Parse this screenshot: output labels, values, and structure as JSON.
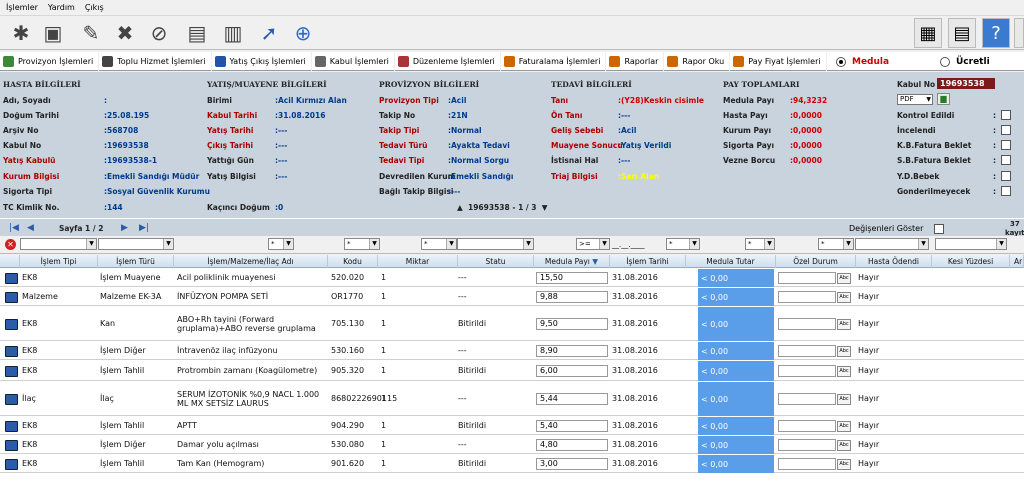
{
  "menu": [
    "İşlemler",
    "Yardım",
    "Çıkış"
  ],
  "tabs": [
    {
      "label": "Provizyon İşlemleri",
      "color": "#3a8a3a"
    },
    {
      "label": "Toplu Hizmet İşlemleri",
      "color": "#333"
    },
    {
      "label": "Yatış Çıkış İşlemleri",
      "color": "#2255aa"
    },
    {
      "label": "Kabul İşlemleri",
      "color": "#555"
    },
    {
      "label": "Düzenleme İşlemleri",
      "color": "#a33"
    },
    {
      "label": "Faturalama İşlemleri",
      "color": "#c60"
    },
    {
      "label": "Raporlar",
      "color": "#c60"
    },
    {
      "label": "Rapor Oku",
      "color": "#c60"
    },
    {
      "label": "Pay Fiyat İşlemleri",
      "color": "#c60"
    }
  ],
  "mode": {
    "medula": "Medula",
    "ucretli": "Ücretli"
  },
  "hasta": {
    "title": "HASTA BİLGİLERİ",
    "rows": [
      {
        "l": "Adı, Soyadı",
        "v": ""
      },
      {
        "l": "Doğum Tarihi",
        "v": "25.08.195"
      },
      {
        "l": "Arşiv No",
        "v": "568708"
      },
      {
        "l": "Kabul No",
        "v": "19693538"
      },
      {
        "l": "Yatış Kabulü",
        "v": "19693538-1"
      },
      {
        "l": "Kurum Bilgisi",
        "v": "Emekli Sandığı Müdür"
      },
      {
        "l": "Sigorta Tipi",
        "v": "Sosyal Güvenlik Kurumu"
      },
      {
        "l": "TC Kimlik No.",
        "v": "144"
      }
    ]
  },
  "yatis": {
    "title": "YATIŞ/MUAYENE BİLGİLERİ",
    "rows": [
      {
        "l": "Birimi",
        "v": "Acil Kırmızı Alan"
      },
      {
        "l": "Kabul Tarihi",
        "v": "31.08.2016"
      },
      {
        "l": "Yatış Tarihi",
        "v": "---"
      },
      {
        "l": "Çıkış Tarihi",
        "v": "---"
      },
      {
        "l": "Yattığı Gün",
        "v": "---"
      },
      {
        "l": "Yatış Bilgisi",
        "v": "---"
      },
      {
        "l": "Kaçıncı Doğum",
        "v": "0"
      }
    ]
  },
  "provizyon": {
    "title": "PROVİZYON BİLGİLERİ",
    "rows": [
      {
        "l": "Provizyon Tipi",
        "v": "Acil"
      },
      {
        "l": "Takip No",
        "v": "21N"
      },
      {
        "l": "Takip Tipi",
        "v": "Normal"
      },
      {
        "l": "Tedavi Türü",
        "v": "Ayakta Tedavi"
      },
      {
        "l": "Tedavi Tipi",
        "v": "Normal Sorgu"
      },
      {
        "l": "Devredilen Kurum",
        "v": "Emekli Sandığı"
      },
      {
        "l": "Bağlı Takip Bilgisi",
        "v": "---"
      }
    ],
    "nav": "19693538 - 1 / 3"
  },
  "tedavi": {
    "title": "TEDAVİ BİLGİLERİ",
    "rows": [
      {
        "l": "Tanı",
        "v": "(Y28)Keskin cisimle"
      },
      {
        "l": "Ön Tanı",
        "v": "---"
      },
      {
        "l": "Geliş Sebebi",
        "v": "Acil"
      },
      {
        "l": "Muayene Sonucu",
        "v": "Yatış Verildi"
      },
      {
        "l": "İstisnai Hal",
        "v": "---"
      },
      {
        "l": "Triaj Bilgisi",
        "v": "Sarı Alan"
      }
    ]
  },
  "pay": {
    "title": "PAY TOPLAMLARI",
    "rows": [
      {
        "l": "Medula Payı",
        "v": "94,3232"
      },
      {
        "l": "Hasta Payı",
        "v": "0,0000"
      },
      {
        "l": "Kurum Payı",
        "v": "0,0000"
      },
      {
        "l": "Sigorta Payı",
        "v": "0,0000"
      },
      {
        "l": "Vezne Borcu",
        "v": "0,0000"
      }
    ]
  },
  "kabul": {
    "label": "Kabul No :",
    "value": "19693538",
    "pdf": "PDF"
  },
  "flags": [
    "Kontrol Edildi",
    "İncelendi",
    "K.B.Fatura Beklet",
    "S.B.Fatura Beklet",
    "Y.D.Bebek",
    "Gonderilmeyecek"
  ],
  "pager": {
    "page": "Sayfa 1 / 2",
    "toggle": "Değişenleri Göster",
    "count_top": "37",
    "count_bottom": "kayıt"
  },
  "filters": {
    "f1": "*",
    "f2": "*",
    "f3": "*",
    "f4": ">=",
    "f5": "__.__.____",
    "f6": "*",
    "f7": "*",
    "f8": "*"
  },
  "columns": [
    "İşlem Tipi",
    "İşlem Türü",
    "İşlem/Malzeme/İlaç Adı",
    "Kodu",
    "Miktar",
    "Statu",
    "Medula Payı",
    "İşlem Tarihi",
    "Medula Tutar",
    "Özel Durum",
    "Hasta Ödendi",
    "Kesi Yüzdesi",
    "Ar"
  ],
  "rows": [
    {
      "tip": "EK8",
      "tur": "İşlem Muayene",
      "ad": "Acil poliklinik muayenesi",
      "kod": "520.020",
      "miktar": "1",
      "statu": "---",
      "pay": "15,50",
      "tarih": "31.08.2016",
      "tutar": "< 0,00",
      "odendi": "Hayır"
    },
    {
      "tip": "Malzeme",
      "tur": "Malzeme EK-3A",
      "ad": "İNFÜZYON POMPA SETİ",
      "kod": "OR1770",
      "miktar": "1",
      "statu": "---",
      "pay": "9,88",
      "tarih": "31.08.2016",
      "tutar": "< 0,00",
      "odendi": "Hayır"
    },
    {
      "tip": "EK8",
      "tur": "Kan",
      "ad": "ABO+Rh tayini (Forward gruplama)+ABO reverse gruplama",
      "kod": "705.130",
      "miktar": "1",
      "statu": "Bitirildi",
      "pay": "9,50",
      "tarih": "31.08.2016",
      "tutar": "< 0,00",
      "odendi": "Hayır"
    },
    {
      "tip": "EK8",
      "tur": "İşlem Diğer",
      "ad": "İntravenöz ilaç infüzyonu",
      "kod": "530.160",
      "miktar": "1",
      "statu": "---",
      "pay": "8,90",
      "tarih": "31.08.2016",
      "tutar": "< 0,00",
      "odendi": "Hayır"
    },
    {
      "tip": "EK8",
      "tur": "İşlem Tahlil",
      "ad": "Protrombin zamanı (Koagülometre)",
      "kod": "905.320",
      "miktar": "1",
      "statu": "Bitirildi",
      "pay": "6,00",
      "tarih": "31.08.2016",
      "tutar": "< 0,00",
      "odendi": "Hayır"
    },
    {
      "tip": "İlaç",
      "tur": "İlaç",
      "ad": "SERUM İZOTONİK %0,9 NACL 1.000 ML MX SETSİZ LAURUS",
      "kod": "8680222690115",
      "miktar": "1",
      "statu": "---",
      "pay": "5,44",
      "tarih": "31.08.2016",
      "tutar": "< 0,00",
      "odendi": "Hayır"
    },
    {
      "tip": "EK8",
      "tur": "İşlem Tahlil",
      "ad": "APTT",
      "kod": "904.290",
      "miktar": "1",
      "statu": "Bitirildi",
      "pay": "5,40",
      "tarih": "31.08.2016",
      "tutar": "< 0,00",
      "odendi": "Hayır"
    },
    {
      "tip": "EK8",
      "tur": "İşlem Diğer",
      "ad": "Damar yolu açılması",
      "kod": "530.080",
      "miktar": "1",
      "statu": "---",
      "pay": "4,80",
      "tarih": "31.08.2016",
      "tutar": "< 0,00",
      "odendi": "Hayır"
    },
    {
      "tip": "EK8",
      "tur": "İşlem Tahlil",
      "ad": "Tam Kan (Hemogram)",
      "kod": "901.620",
      "miktar": "1",
      "statu": "Bitirildi",
      "pay": "3,00",
      "tarih": "31.08.2016",
      "tutar": "< 0,00",
      "odendi": "Hayır"
    }
  ]
}
